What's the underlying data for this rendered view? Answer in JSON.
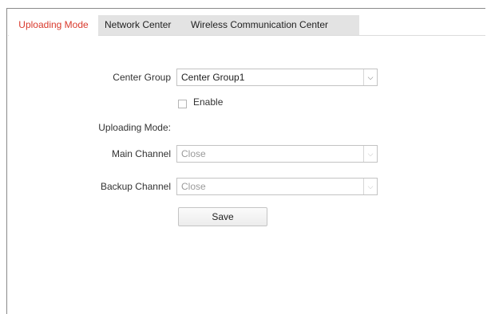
{
  "tabs": [
    {
      "label": "Uploading Mode",
      "active": true
    },
    {
      "label": "Network Center",
      "active": false
    },
    {
      "label": "Wireless Communication Center",
      "active": false
    }
  ],
  "form": {
    "center_group_label": "Center Group",
    "center_group_value": "Center Group1",
    "enable_label": "Enable",
    "enable_checked": false,
    "uploading_mode_label": "Uploading Mode:",
    "main_channel_label": "Main Channel",
    "main_channel_value": "Close",
    "backup_channel_label": "Backup Channel",
    "backup_channel_value": "Close",
    "save_label": "Save"
  },
  "icons": {
    "dropdown": "chevron-down-icon"
  },
  "colors": {
    "active_tab_text": "#d9392c",
    "tab_bar_background": "#e3e3e3"
  }
}
